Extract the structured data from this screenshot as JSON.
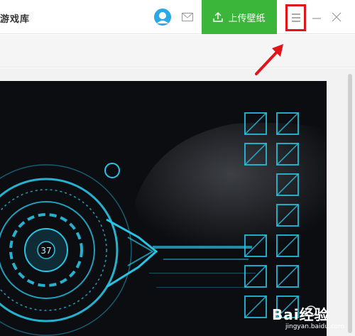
{
  "app": {
    "title": "游戏库"
  },
  "header": {
    "upload_label": "上传壁纸"
  },
  "icons": {
    "avatar": "user-avatar-icon",
    "mail": "mail-icon",
    "upload": "upload-icon",
    "menu": "hamburger-menu-icon",
    "minimize": "minimize-icon",
    "close": "close-icon"
  },
  "watermark": {
    "brand": "Bai经验",
    "url": "jingyan.baidu.com"
  },
  "colors": {
    "accent": "#3bb63b",
    "highlight": "#e1141c",
    "avatar": "#2aa8e8",
    "hud": "#27c4e6"
  },
  "wallpaper": {
    "gauge_value": "37"
  }
}
